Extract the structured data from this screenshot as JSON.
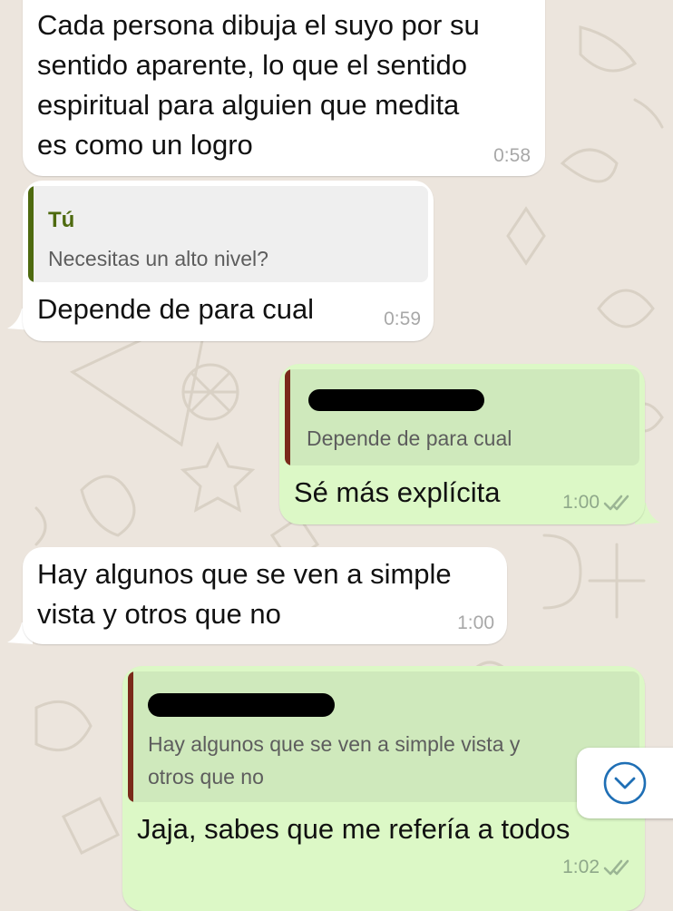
{
  "chat": {
    "messages": [
      {
        "text_lines": [
          "Cada persona dibuja el suyo por su",
          "sentido aparente, lo que el sentido",
          "espiritual para alguien que medita",
          "es como un logro"
        ],
        "time": "0:58"
      },
      {
        "quote": {
          "author": "Tú",
          "text": "Necesitas un alto nivel?"
        },
        "text": "Depende de para cual",
        "time": "0:59"
      },
      {
        "quote": {
          "text": "Depende de para cual"
        },
        "text": "Sé más explícita",
        "time": "1:00"
      },
      {
        "text_lines": [
          "Hay algunos que se ven a simple",
          "vista y otros que no"
        ],
        "time": "1:00"
      },
      {
        "quote": {
          "text_lines": [
            "Hay algunos que se ven a simple vista y",
            "otros que no"
          ]
        },
        "text": "Jaja, sabes que me refería a todos",
        "time": "1:02"
      }
    ]
  },
  "icons": {
    "read_ticks": "double-check-icon",
    "scroll_down": "chevron-down-circle-icon"
  },
  "colors": {
    "incoming_bubble": "#ffffff",
    "outgoing_bubble": "#dcf8c6",
    "quote_bar_self": "#4e6a0f",
    "quote_bar_contact": "#7a2a1a",
    "scroll_icon": "#1f6fb5"
  }
}
